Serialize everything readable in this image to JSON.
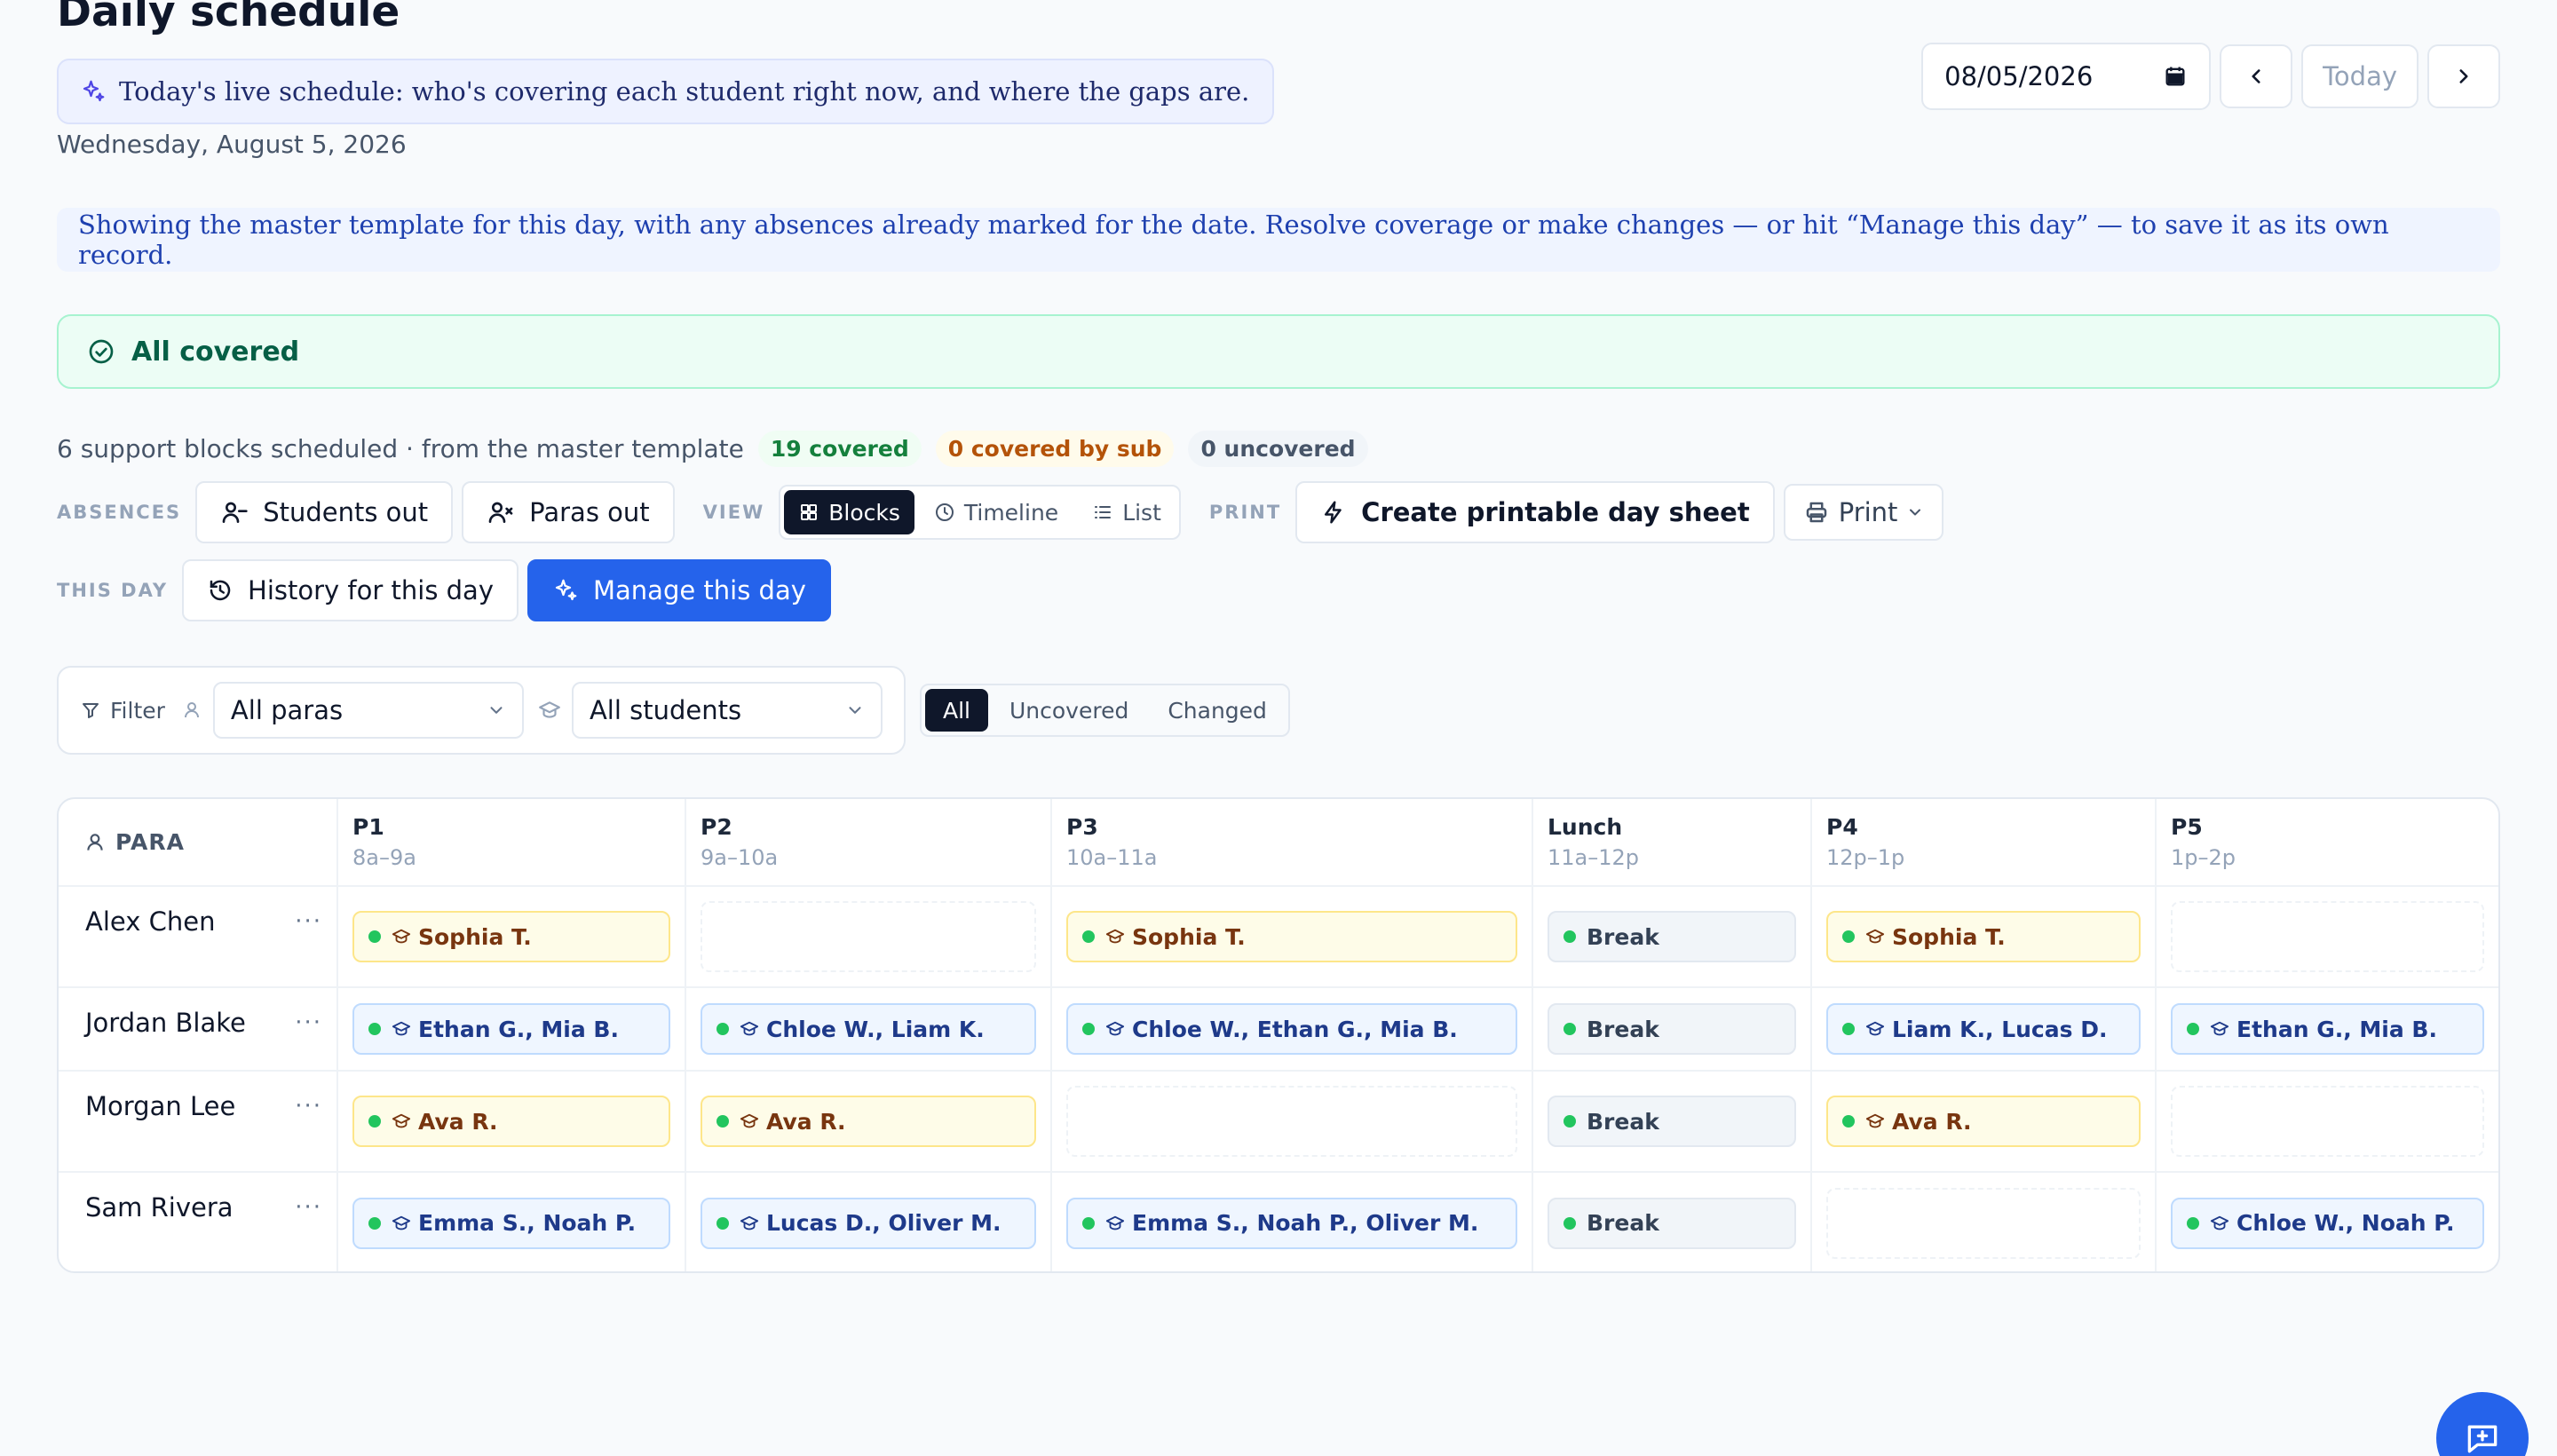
{
  "header": {
    "title": "Daily schedule",
    "ai_banner": "Today's live schedule: who's covering each student right now, and where the gaps are.",
    "date_line": "Wednesday, August 5, 2026",
    "date_value": "08/05/2026",
    "today_label": "Today"
  },
  "info_banner": "Showing the master template for this day, with any absences already marked for the date. Resolve coverage or make changes — or hit “Manage this day” — to save it as its own record.",
  "status": {
    "label": "All covered"
  },
  "summary": {
    "text": "6 support blocks scheduled · from the master template",
    "covered": "19 covered",
    "covered_by_sub": "0 covered by sub",
    "uncovered": "0 uncovered"
  },
  "toolbar": {
    "absences_label": "ABSENCES",
    "students_out": "Students out",
    "paras_out": "Paras out",
    "view_label": "VIEW",
    "view_blocks": "Blocks",
    "view_timeline": "Timeline",
    "view_list": "List",
    "print_label": "PRINT",
    "create_sheet": "Create printable day sheet",
    "print": "Print",
    "this_day_label": "THIS DAY",
    "history": "History for this day",
    "manage": "Manage this day"
  },
  "filters": {
    "label": "Filter",
    "paras_value": "All paras",
    "students_value": "All students",
    "seg_all": "All",
    "seg_uncovered": "Uncovered",
    "seg_changed": "Changed"
  },
  "grid": {
    "para_header": "PARA",
    "periods": [
      {
        "name": "P1",
        "time": "8a–9a"
      },
      {
        "name": "P2",
        "time": "9a–10a"
      },
      {
        "name": "P3",
        "time": "10a–11a"
      },
      {
        "name": "Lunch",
        "time": "11a–12p"
      },
      {
        "name": "P4",
        "time": "12p–1p"
      },
      {
        "name": "P5",
        "time": "1p–2p"
      }
    ],
    "rows": [
      {
        "para": "Alex Chen",
        "more": "···",
        "cells": [
          "Sophia T.",
          "",
          "Sophia T.",
          "Break",
          "Sophia T.",
          ""
        ]
      },
      {
        "para": "Jordan Blake",
        "more": "···",
        "cells": [
          "Ethan G., Mia B.",
          "Chloe W., Liam K.",
          "Chloe W., Ethan G., Mia B.",
          "Break",
          "Liam K., Lucas D.",
          "Ethan G., Mia B."
        ]
      },
      {
        "para": "Morgan Lee",
        "more": "···",
        "cells": [
          "Ava R.",
          "Ava R.",
          "",
          "Break",
          "Ava R.",
          ""
        ]
      },
      {
        "para": "Sam Rivera",
        "more": "···",
        "cells": [
          "Emma S., Noah P.",
          "Lucas D., Oliver M.",
          "Emma S., Noah P., Oliver M.",
          "Break",
          "",
          "Chloe W., Noah P."
        ]
      }
    ]
  },
  "colors": {
    "primary": "#2563eb",
    "covered_green": "#15803d",
    "sub_amber": "#b45309",
    "dark": "#0f172a"
  }
}
